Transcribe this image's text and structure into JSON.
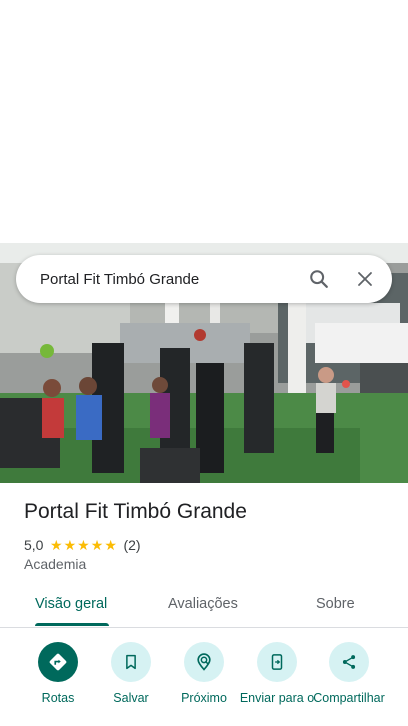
{
  "search": {
    "query": "Portal Fit Timbó Grande"
  },
  "place": {
    "name": "Portal Fit Timbó Grande",
    "rating": "5,0",
    "star_count": 5,
    "review_count": "(2)",
    "category": "Academia"
  },
  "tabs": [
    {
      "label": "Visão geral",
      "active": true
    },
    {
      "label": "Avaliações",
      "active": false
    },
    {
      "label": "Sobre",
      "active": false
    }
  ],
  "actions": [
    {
      "label": "Rotas",
      "icon": "directions-icon"
    },
    {
      "label": "Salvar",
      "icon": "bookmark-icon"
    },
    {
      "label": "Próximo",
      "icon": "nearby-icon"
    },
    {
      "label": "Enviar para o",
      "icon": "send-to-phone-icon"
    },
    {
      "label": "Compartilhar",
      "icon": "share-icon"
    }
  ],
  "colors": {
    "accent": "#00695c",
    "action_bg": "#d6f2f3",
    "star": "#fbbc04"
  }
}
